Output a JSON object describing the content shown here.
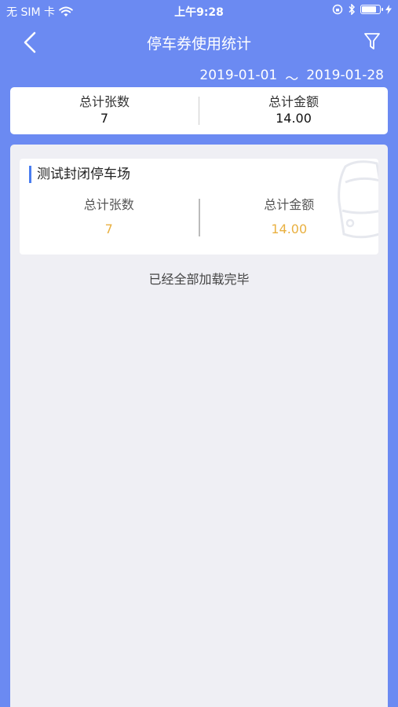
{
  "status": {
    "carrier": "无 SIM 卡",
    "time": "上午9:28",
    "battery_level": 0.85
  },
  "nav": {
    "title": "停车券使用统计",
    "back_icon": "chevron-left-icon",
    "filter_icon": "filter-icon"
  },
  "date_range": {
    "start": "2019-01-01",
    "separator": "～",
    "end": "2019-01-28"
  },
  "summary": {
    "count_label": "总计张数",
    "count_value": "7",
    "amount_label": "总计金额",
    "amount_value": "14.00"
  },
  "lots": [
    {
      "name": "测试封闭停车场",
      "count_label": "总计张数",
      "count_value": "7",
      "amount_label": "总计金额",
      "amount_value": "14.00"
    }
  ],
  "end_text": "已经全部加载完毕",
  "colors": {
    "primary": "#6b8af2",
    "accent": "#4a7df0",
    "value_highlight": "#e9b040"
  }
}
